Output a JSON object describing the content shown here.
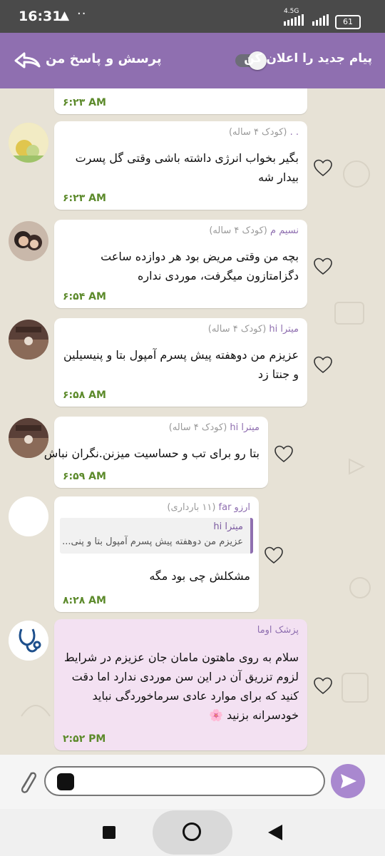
{
  "status_bar": {
    "time": "16:31",
    "warning_icon": "▲",
    "dots": "··",
    "network_type": "4.5G",
    "battery": "61"
  },
  "header": {
    "title": "پرسش و پاسخ من",
    "announce_label": "پیام جدید را اعلان کن",
    "toggle_state": "off"
  },
  "messages": [
    {
      "sender": "",
      "role": "",
      "text": "",
      "time": "۶:۲۳ AM"
    },
    {
      "sender": ". .",
      "role": " (کودک ۴ ساله)",
      "text": "بگیر بخواب انرژی داشته باشی وقتی گل پسرت بیدار شه",
      "time": "۶:۲۳ AM"
    },
    {
      "sender": "نسیم م",
      "role": " (کودک ۴ ساله)",
      "text": "بچه من وقتی مریض بود هر دوازده ساعت دگزامتازون میگرفت، موردی نداره",
      "time": "۶:۵۴ AM"
    },
    {
      "sender": "میترا hi",
      "role": " (کودک ۴ ساله)",
      "text": "عزیزم من دوهفته پیش پسرم آمپول بتا و پنیسیلین و جنتا زد",
      "time": "۶:۵۸ AM"
    },
    {
      "sender": "میترا hi",
      "role": " (کودک ۴ ساله)",
      "text": "بتا رو برای تب و حساسیت میزنن.نگران نباش",
      "time": "۶:۵۹ AM"
    },
    {
      "sender": "ارزو far",
      "role": " (۱۱ بارداری)",
      "reply_name": "میترا hi",
      "reply_text": "عزیزم من دوهفته پیش پسرم آمپول بتا و پنی...",
      "text": "مشکلش چی بود مگه",
      "time": "۸:۲۸ AM"
    },
    {
      "sender": "پزشک اوما",
      "role": "",
      "text": "سلام به روی ماهتون مامان جان عزیزم در شرایط لزوم تزریق آن در این سن موردی ندارد اما دقت کنید که برای موارد عادی سرماخوردگی نباید خودسرانه بزنید 🌸",
      "time": "۲:۵۲ PM"
    }
  ],
  "input": {
    "placeholder": ""
  },
  "colors": {
    "header": "#8f6fb0",
    "timestamp": "#5c8a2b",
    "doctor_bubble": "#f3e1f2",
    "send_button": "#a988cf"
  }
}
